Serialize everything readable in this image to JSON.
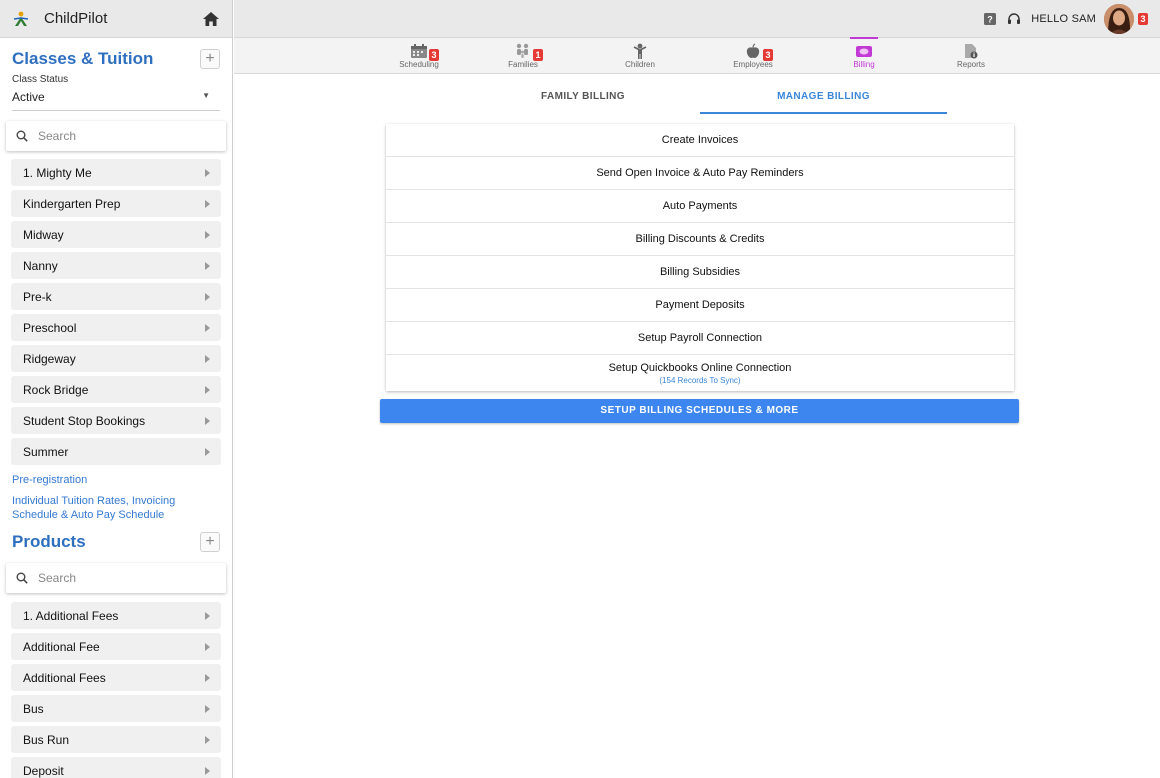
{
  "app": {
    "name": "ChildPilot"
  },
  "topbar": {
    "greeting": "HELLO SAM",
    "notifications": "3"
  },
  "modules": [
    {
      "label": "Scheduling",
      "badge": "3",
      "icon": "calendar-icon"
    },
    {
      "label": "Families",
      "badge": "1",
      "icon": "family-icon"
    },
    {
      "label": "Children",
      "badge": "",
      "icon": "child-icon"
    },
    {
      "label": "Employees",
      "badge": "3",
      "icon": "apple-icon"
    },
    {
      "label": "Billing",
      "badge": "",
      "icon": "billing-icon",
      "active": true
    },
    {
      "label": "Reports",
      "badge": "",
      "icon": "report-icon"
    }
  ],
  "sidebar": {
    "classes": {
      "title": "Classes & Tuition",
      "status_label": "Class Status",
      "status_value": "Active",
      "search_placeholder": "Search",
      "items": [
        "1. Mighty Me",
        "Kindergarten Prep",
        "Midway",
        "Nanny",
        "Pre-k",
        "Preschool",
        "Ridgeway",
        "Rock Bridge",
        "Student Stop Bookings",
        "Summer"
      ],
      "link_preregistration": "Pre-registration",
      "link_tuition_line1": "Individual Tuition Rates, Invoicing",
      "link_tuition_line2": "Schedule & Auto Pay Schedule"
    },
    "products": {
      "title": "Products",
      "search_placeholder": "Search",
      "items": [
        "1. Additional Fees",
        "Additional Fee",
        "Additional Fees",
        "Bus",
        "Bus Run",
        "Deposit"
      ]
    }
  },
  "tabs": {
    "family_billing": "FAMILY BILLING",
    "manage_billing": "MANAGE BILLING"
  },
  "menu": {
    "items": [
      "Create Invoices",
      "Send Open Invoice & Auto Pay Reminders",
      "Auto Payments",
      "Billing Discounts & Credits",
      "Billing Subsidies",
      "Payment Deposits",
      "Setup Payroll Connection",
      "Setup Quickbooks Online Connection"
    ],
    "quickbooks_sub": "(154 Records To Sync)"
  },
  "primary_button": "SETUP BILLING SCHEDULES & MORE",
  "colors": {
    "accent_blue": "#3a86d9",
    "billing_purple": "#c23ad6",
    "badge_red": "#e53935",
    "button_blue": "#3d86f0"
  }
}
